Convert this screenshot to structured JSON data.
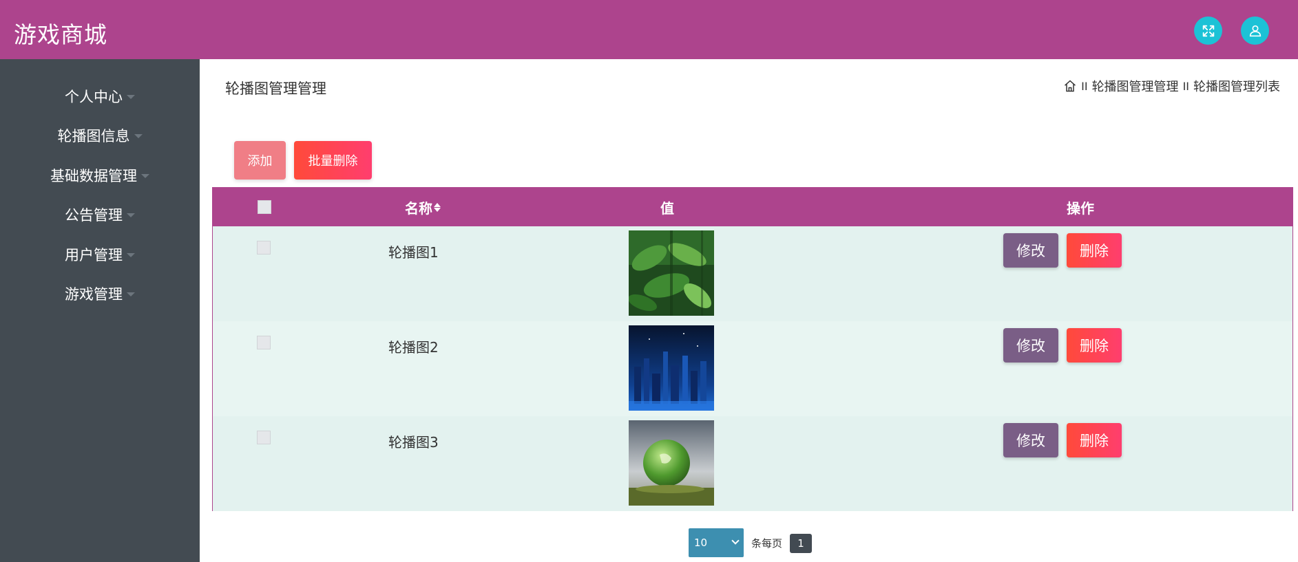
{
  "header": {
    "brand": "游戏商城",
    "fullscreen_icon": "expand-arrows-icon",
    "user_icon": "user-icon"
  },
  "sidebar": {
    "items": [
      {
        "label": "个人中心"
      },
      {
        "label": "轮播图信息"
      },
      {
        "label": "基础数据管理"
      },
      {
        "label": "公告管理"
      },
      {
        "label": "用户管理"
      },
      {
        "label": "游戏管理"
      }
    ]
  },
  "main": {
    "title": "轮播图管理管理",
    "breadcrumb": {
      "separator": "II",
      "items": [
        "轮播图管理管理",
        "轮播图管理列表"
      ]
    },
    "toolbar": {
      "add_label": "添加",
      "batch_delete_label": "批量删除"
    },
    "table": {
      "columns": [
        "名称",
        "值",
        "操作"
      ],
      "rows": [
        {
          "name": "轮播图1",
          "image": "jungle-leaves"
        },
        {
          "name": "轮播图2",
          "image": "night-city"
        },
        {
          "name": "轮播图3",
          "image": "green-globe"
        }
      ],
      "edit_label": "修改",
      "delete_label": "删除"
    },
    "pagination": {
      "page_size": "10",
      "per_page_label": "条每页",
      "current_page": "1"
    }
  },
  "colors": {
    "header_bg": "#ad448d",
    "sidebar_bg": "#434b52",
    "accent_cyan": "#1cc2d6",
    "edit_button": "#7a5e86",
    "delete_button": "#ff4a3a",
    "add_button": "#f07e86",
    "row_bg": "#e3f2ef"
  }
}
